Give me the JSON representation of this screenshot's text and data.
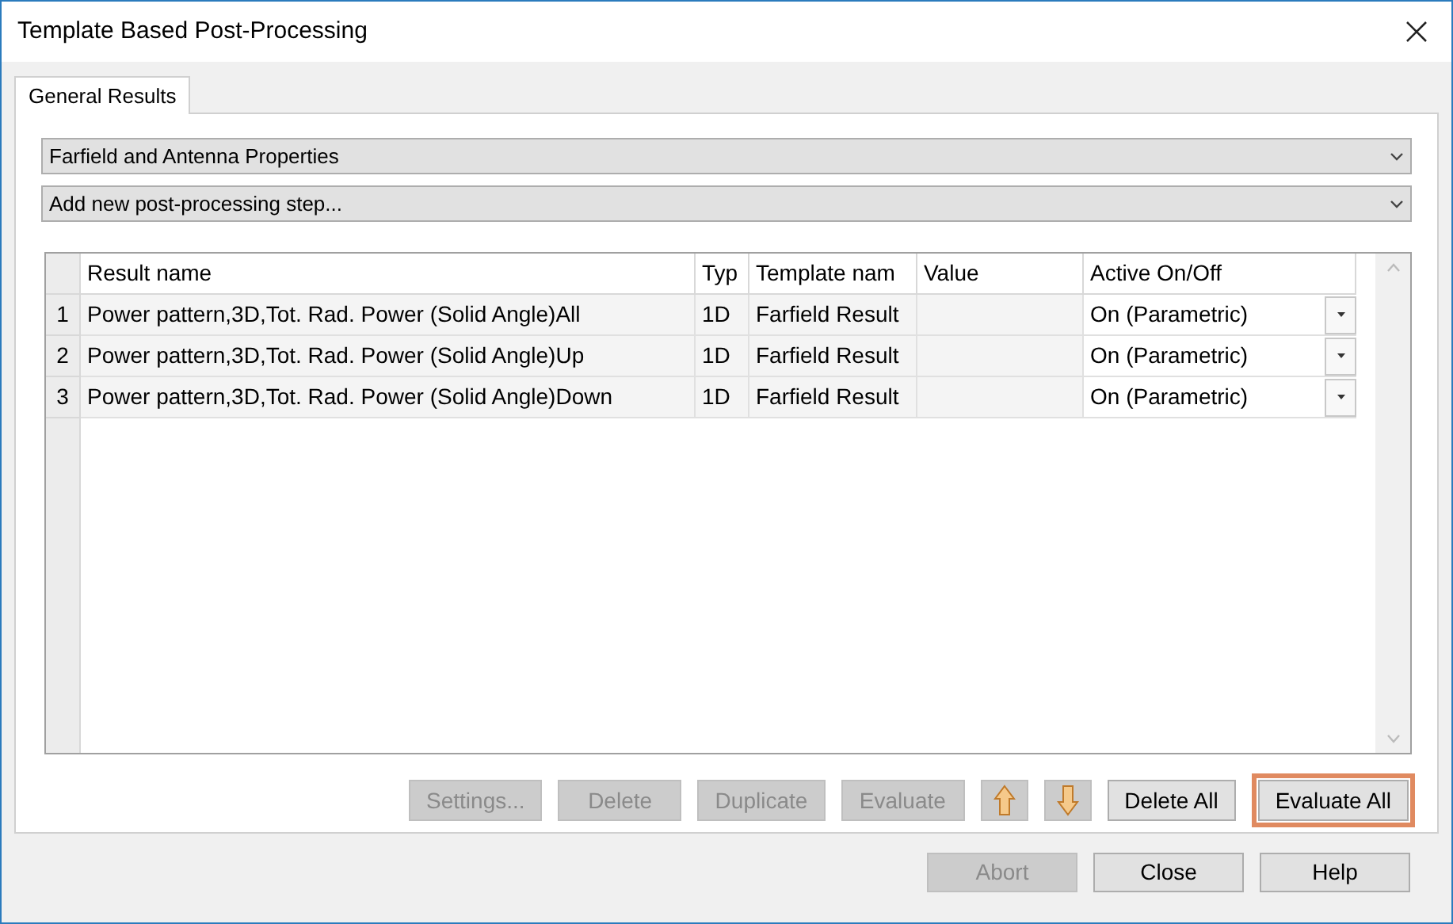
{
  "window": {
    "title": "Template Based Post-Processing"
  },
  "tabs": [
    {
      "label": "General Results",
      "selected": true
    }
  ],
  "dropdowns": [
    {
      "value": "Farfield and Antenna Properties"
    },
    {
      "value": "Add new post-processing step..."
    }
  ],
  "table": {
    "columns": [
      "Result name",
      "Typ",
      "Template nam",
      "Value",
      "Active On/Off"
    ],
    "rows": [
      {
        "index": "1",
        "name": "Power pattern,3D,Tot. Rad. Power (Solid Angle)All",
        "type": "1D",
        "template": "Farfield Result",
        "active": "On (Parametric)"
      },
      {
        "index": "2",
        "name": "Power pattern,3D,Tot. Rad. Power (Solid Angle)Up",
        "type": "1D",
        "template": "Farfield Result",
        "active": "On (Parametric)"
      },
      {
        "index": "3",
        "name": "Power pattern,3D,Tot. Rad. Power (Solid Angle)Down",
        "type": "1D",
        "template": "Farfield Result",
        "active": "On (Parametric)"
      }
    ]
  },
  "actions": [
    {
      "kind": "text",
      "label": "Settings...",
      "disabled": true,
      "highlighted": false
    },
    {
      "kind": "text",
      "label": "Delete",
      "disabled": true,
      "highlighted": false
    },
    {
      "kind": "text",
      "label": "Duplicate",
      "disabled": true,
      "highlighted": false
    },
    {
      "kind": "text",
      "label": "Evaluate",
      "disabled": true,
      "highlighted": false
    },
    {
      "kind": "up",
      "disabled": true,
      "highlighted": false
    },
    {
      "kind": "down",
      "disabled": true,
      "highlighted": false
    },
    {
      "kind": "text",
      "label": "Delete All",
      "disabled": false,
      "highlighted": false
    },
    {
      "kind": "text",
      "label": "Evaluate All",
      "disabled": false,
      "highlighted": true
    }
  ],
  "footer_buttons": [
    {
      "label": "Abort",
      "disabled": true
    },
    {
      "label": "Close",
      "disabled": false
    },
    {
      "label": "Help",
      "disabled": false
    }
  ]
}
